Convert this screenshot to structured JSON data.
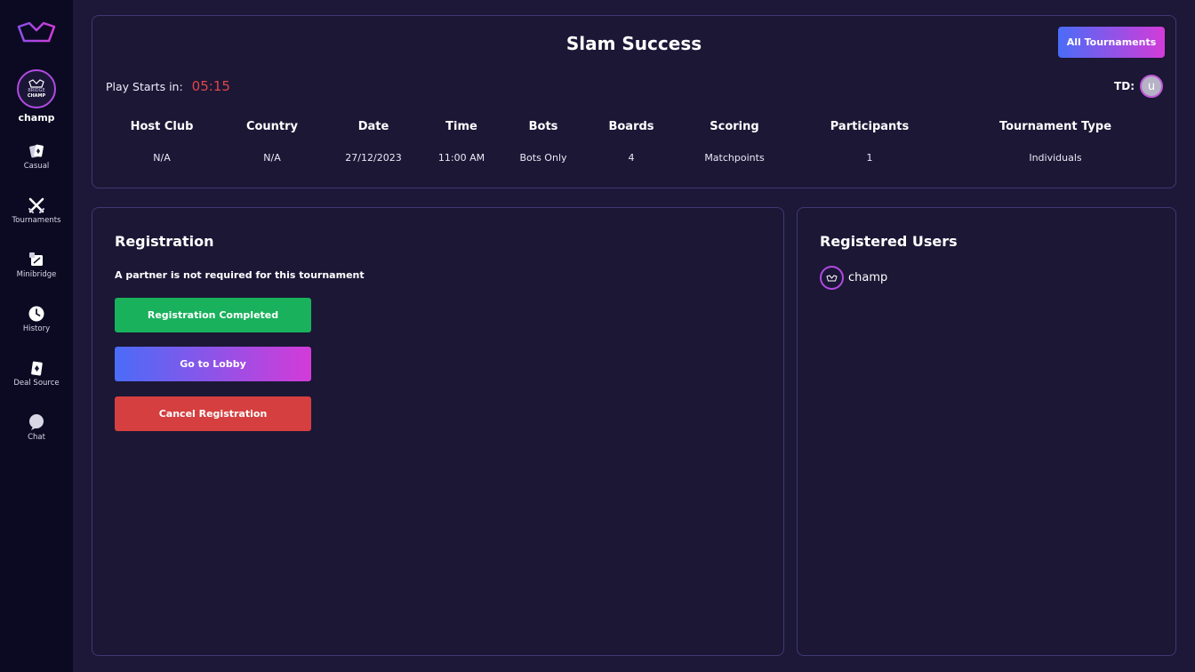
{
  "sidebar": {
    "profile": {
      "avatar_text": "BRIDGE\nCHAMP",
      "avatar_line1": "BRIDGE",
      "avatar_line2": "CHAMP",
      "name": "champ"
    },
    "items": [
      {
        "label": "Casual",
        "icon": "cards-icon"
      },
      {
        "label": "Tournaments",
        "icon": "crossed-swords-icon"
      },
      {
        "label": "Minibridge",
        "icon": "minibridge-icon"
      },
      {
        "label": "History",
        "icon": "clock-icon"
      },
      {
        "label": "Deal Source",
        "icon": "card-deal-icon"
      },
      {
        "label": "Chat",
        "icon": "chat-bubble-icon"
      }
    ]
  },
  "header": {
    "title": "Slam Success",
    "all_tournaments_label": "All Tournaments",
    "play_starts_label": "Play Starts in:",
    "play_starts_time": "05:15",
    "td_label": "TD:",
    "td_avatar_letter": "u",
    "info": [
      {
        "label": "Host Club",
        "value": "N/A"
      },
      {
        "label": "Country",
        "value": "N/A"
      },
      {
        "label": "Date",
        "value": "27/12/2023"
      },
      {
        "label": "Time",
        "value": "11:00 AM"
      },
      {
        "label": "Bots",
        "value": "Bots Only"
      },
      {
        "label": "Boards",
        "value": "4"
      },
      {
        "label": "Scoring",
        "value": "Matchpoints"
      },
      {
        "label": "Participants",
        "value": "1"
      },
      {
        "label": "Tournament Type",
        "value": "Individuals"
      }
    ]
  },
  "registration": {
    "title": "Registration",
    "partner_note": "A partner is not required for this tournament",
    "completed_label": "Registration Completed",
    "lobby_label": "Go to Lobby",
    "cancel_label": "Cancel Registration"
  },
  "registered_users": {
    "title": "Registered Users",
    "users": [
      {
        "name": "champ"
      }
    ]
  },
  "colors": {
    "accent_gradient_start": "#4a6cf7",
    "accent_gradient_end": "#d33bd8",
    "success": "#19b15c",
    "danger": "#d53f3f",
    "timer": "#e0454a"
  }
}
